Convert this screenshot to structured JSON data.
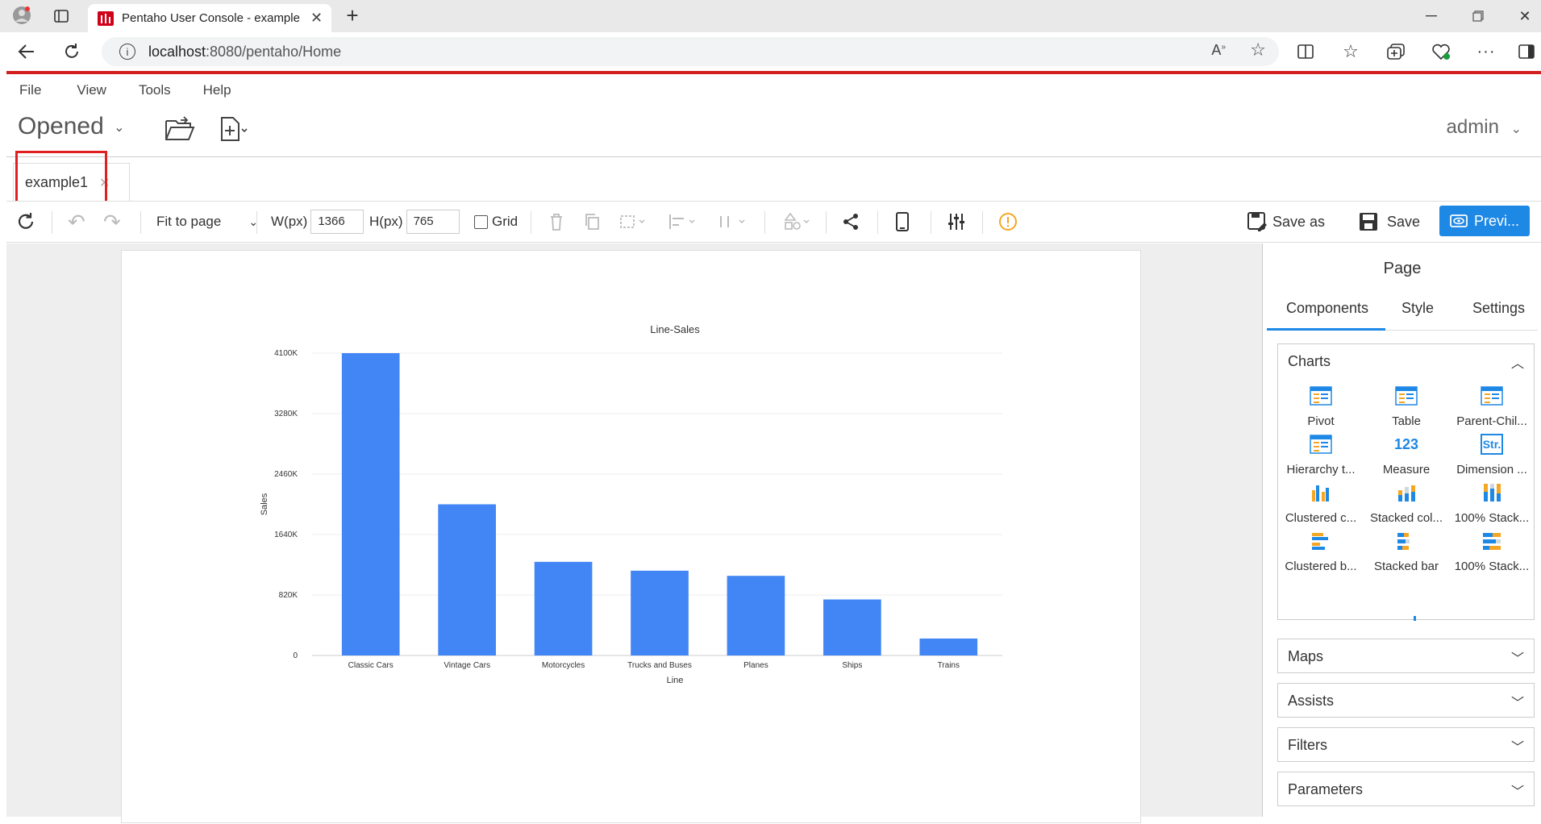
{
  "browser": {
    "tab_title": "Pentaho User Console - example",
    "url_host": "localhost",
    "url_rest": ":8080/pentaho/Home"
  },
  "app": {
    "menu": [
      "File",
      "View",
      "Tools",
      "Help"
    ],
    "opened_label": "Opened",
    "user_label": "admin",
    "doc_tab_label": "example1",
    "toolbar": {
      "fit_label": "Fit to page",
      "w_label": "W(px)",
      "w_value": "1366",
      "h_label": "H(px)",
      "h_value": "765",
      "grid_label": "Grid",
      "save_as_label": "Save as",
      "save_label": "Save",
      "preview_label": "Previ..."
    }
  },
  "panel": {
    "title": "Page",
    "tabs": [
      "Components",
      "Style",
      "Settings"
    ],
    "sections": {
      "charts": "Charts",
      "maps": "Maps",
      "assists": "Assists",
      "filters": "Filters",
      "parameters": "Parameters"
    },
    "components": [
      {
        "label": "Pivot",
        "icon": "pivot-icon"
      },
      {
        "label": "Table",
        "icon": "table-icon"
      },
      {
        "label": "Parent-Chil...",
        "icon": "parent-child-icon"
      },
      {
        "label": "Hierarchy t...",
        "icon": "hierarchy-table-icon"
      },
      {
        "label": "Measure",
        "icon": "measure-icon",
        "glyph": "123"
      },
      {
        "label": "Dimension ...",
        "icon": "dimension-icon",
        "glyph": "Str."
      },
      {
        "label": "Clustered c...",
        "icon": "clustered-column-icon"
      },
      {
        "label": "Stacked col...",
        "icon": "stacked-column-icon"
      },
      {
        "label": "100% Stack...",
        "icon": "100-stacked-column-icon"
      },
      {
        "label": "Clustered b...",
        "icon": "clustered-bar-icon"
      },
      {
        "label": "Stacked bar",
        "icon": "stacked-bar-icon"
      },
      {
        "label": "100% Stack...",
        "icon": "100-stacked-bar-icon"
      }
    ]
  },
  "chart_data": {
    "type": "bar",
    "title": "Line-Sales",
    "xlabel": "Line",
    "ylabel": "Sales",
    "categories": [
      "Classic Cars",
      "Vintage Cars",
      "Motorcycles",
      "Trucks and Buses",
      "Planes",
      "Ships",
      "Trains"
    ],
    "values": [
      4100000,
      2050000,
      1270000,
      1150000,
      1080000,
      760000,
      230000
    ],
    "yticks": [
      "0",
      "820K",
      "1640K",
      "2460K",
      "3280K",
      "4100K"
    ],
    "ylim": [
      0,
      4100000
    ],
    "bar_color": "#4285f4",
    "grid": true
  }
}
